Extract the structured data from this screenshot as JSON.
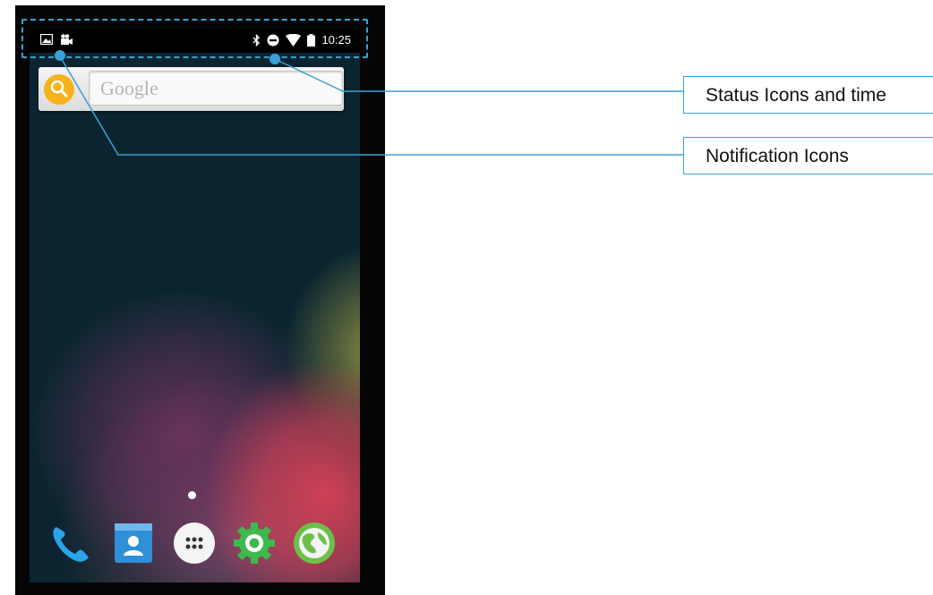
{
  "status_bar": {
    "notification_icons": [
      "image-icon",
      "video-camera-icon"
    ],
    "status_icons": [
      "bluetooth-icon",
      "do-not-disturb-icon",
      "wifi-icon",
      "battery-icon"
    ],
    "time": "10:25"
  },
  "search_widget": {
    "placeholder": "Google",
    "icon": "search-icon"
  },
  "dock": {
    "apps": [
      "phone-icon",
      "contacts-icon",
      "app-drawer-icon",
      "settings-icon",
      "browser-icon"
    ]
  },
  "callouts": {
    "status": "Status Icons and time",
    "notification": "Notification Icons"
  },
  "colors": {
    "accent": "#3aa1d6",
    "search_button": "#f6b21a",
    "wallpaper_base": "#0b2530"
  }
}
